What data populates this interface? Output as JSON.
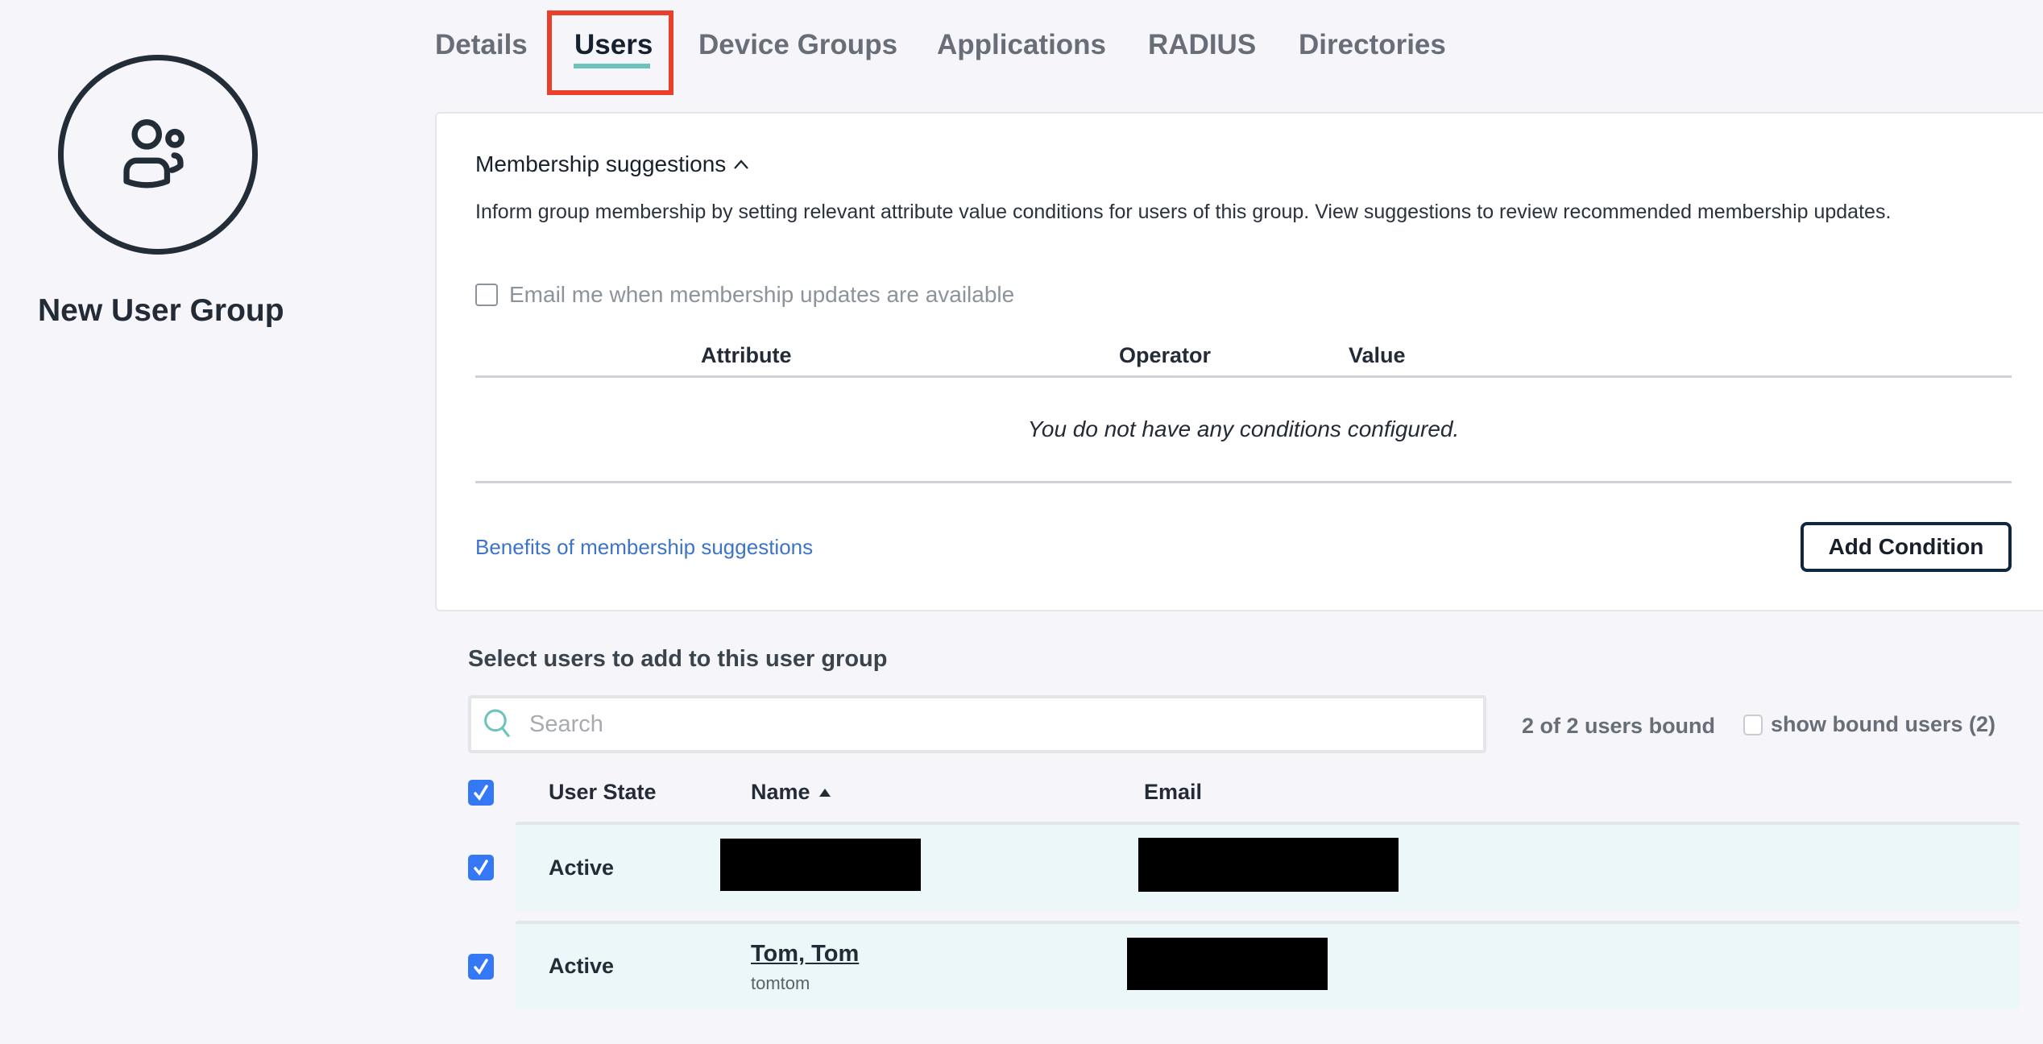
{
  "group": {
    "title": "New User Group",
    "icon": "user-group-icon"
  },
  "tabs": [
    {
      "label": "Details",
      "active": false
    },
    {
      "label": "Users",
      "active": true
    },
    {
      "label": "Device Groups",
      "active": false
    },
    {
      "label": "Applications",
      "active": false
    },
    {
      "label": "RADIUS",
      "active": false
    },
    {
      "label": "Directories",
      "active": false
    }
  ],
  "colors": {
    "accent_underline": "#6dc4bd",
    "highlight_box": "#e8402a",
    "checkbox_checked": "#3478f6",
    "link": "#3d74c8",
    "row_background": "#ebf7f8"
  },
  "membership": {
    "title": "Membership suggestions",
    "toggle_icon": "chevron-up-icon",
    "description": "Inform group membership by setting relevant attribute value conditions for users of this group. View suggestions to review recommended membership updates.",
    "email_option": {
      "label": "Email me when membership updates are available",
      "checked": false
    },
    "columns": [
      "Attribute",
      "Operator",
      "Value"
    ],
    "empty_message": "You do not have any conditions configured.",
    "benefits_link": "Benefits of membership suggestions",
    "add_button": "Add Condition"
  },
  "users_section": {
    "title": "Select users to add to this user group",
    "search": {
      "placeholder": "Search",
      "value": ""
    },
    "bound_count": "2 of 2 users bound",
    "show_bound": {
      "label": "show bound users (2)",
      "checked": false
    },
    "select_all_checked": true,
    "columns": {
      "state": "User State",
      "name": "Name",
      "email": "Email"
    },
    "sort": {
      "column": "Name",
      "direction": "ascending",
      "icon": "sort-up-icon"
    },
    "rows": [
      {
        "checked": true,
        "state": "Active",
        "name": "[redacted]",
        "username": "",
        "email": "[redacted]"
      },
      {
        "checked": true,
        "state": "Active",
        "name": "Tom, Tom",
        "username": "tomtom",
        "email": "[redacted]"
      }
    ]
  }
}
